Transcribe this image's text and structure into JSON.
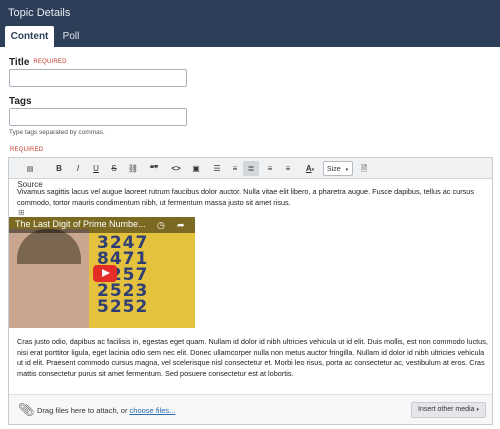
{
  "header": {
    "title": "Topic Details"
  },
  "tabs": [
    {
      "label": "Content",
      "active": true
    },
    {
      "label": "Poll",
      "active": false
    }
  ],
  "form": {
    "title_label": "Title",
    "title_required": "REQUIRED",
    "title_value": "",
    "tags_label": "Tags",
    "tags_value": "",
    "tags_help": "Type tags separated by commas.",
    "body_required": "REQUIRED"
  },
  "toolbar": {
    "source": "Source",
    "bold": "B",
    "italic": "I",
    "underline": "U",
    "strike": "S",
    "quote": "❝❞",
    "code": "<>",
    "size": "Size"
  },
  "content": {
    "para1_a": "Vivamus sagittis lacus vel augue laoreet rutrum faucibus dolor auctor. Nulla vitae elit libero, a pharetra augue. Fusce dapibus, tellus ac cursus",
    "para1_b": "commodo, tortor mauris condimentum nibh, ut fermentum massa justo sit amet risus.",
    "video_title": "The Last Digit of Prime Numbe...",
    "video_digits": [
      "3247",
      "8471",
      "9257",
      "2523",
      "5252"
    ],
    "para2_lines": [
      "Cras justo odio, dapibus ac facilisis in, egestas eget quam. Nullam id dolor id nibh ultricies vehicula ut id elit. Duis mollis, est non commodo luctus,",
      "nisi erat porttitor ligula, eget lacinia odio sem nec elit. Donec ullamcorper nulla non metus auctor fringilla. Nullam id dolor id nibh ultricies vehicula",
      "ut id elit. Praesent commodo cursus magna, vel scelerisque nisl consectetur et. Morbi leo risus, porta ac consectetur ac, vestibulum at eros. Cras",
      "mattis consectetur purus sit amet fermentum. Sed posuere consectetur est at lobortis."
    ]
  },
  "attach": {
    "text": "Drag files here to attach, or ",
    "link": "choose files...",
    "insert_button": "Insert other media"
  },
  "colors": {
    "header_bg": "#2d3f58",
    "required": "#c0392b",
    "link": "#2a6db0"
  }
}
